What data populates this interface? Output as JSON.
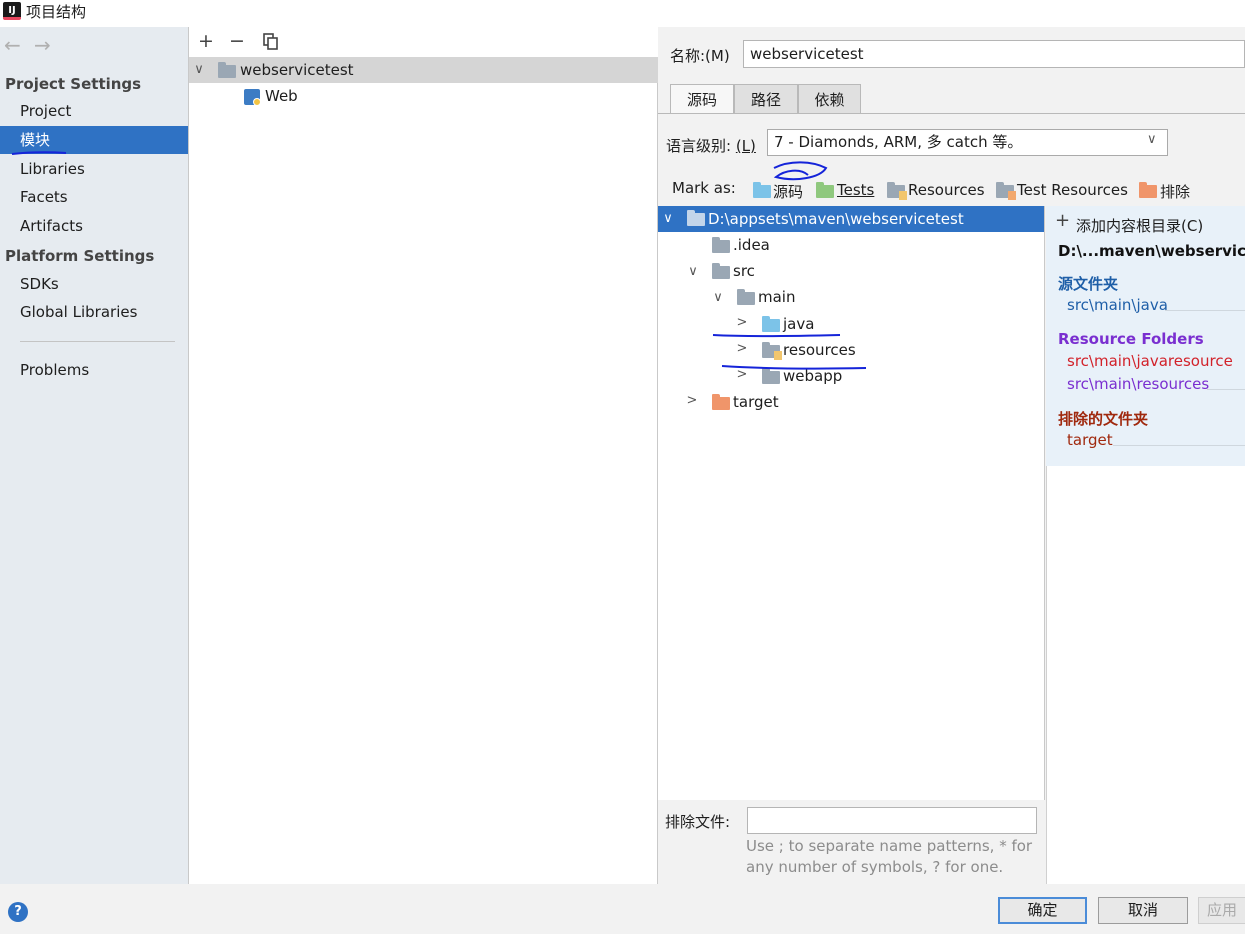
{
  "window": {
    "title": "项目结构",
    "app_icon": "IJ"
  },
  "nav": {
    "back_icon": "arrow-left-icon",
    "forward_icon": "arrow-right-icon",
    "project_settings_header": "Project Settings",
    "project_items": [
      "Project",
      "模块",
      "Libraries",
      "Facets",
      "Artifacts"
    ],
    "platform_settings_header": "Platform Settings",
    "platform_items": [
      "SDKs",
      "Global Libraries"
    ],
    "problems": "Problems",
    "selected": "模块"
  },
  "modules": {
    "toolbar": {
      "add": "+",
      "remove": "−",
      "copy": "copy-icon"
    },
    "tree": [
      {
        "label": "webservicetest"
      },
      {
        "label": "Web"
      }
    ]
  },
  "module": {
    "name_label": "名称:(M)",
    "name_value": "webservicetest",
    "tabs": [
      "源码",
      "路径",
      "依赖"
    ],
    "active_tab": "源码",
    "lang_label": "语言级别:",
    "lang_shortcut": "(L)",
    "lang_value": "7 - Diamonds, ARM, 多 catch 等。",
    "mark_as_label": "Mark as:",
    "mark_as": [
      "源码",
      "Tests",
      "Resources",
      "Test Resources",
      "排除"
    ],
    "tree": {
      "root": "D:\\appsets\\maven\\webservicetest",
      "idea": ".idea",
      "src": "src",
      "main": "main",
      "java": "java",
      "resources": "resources",
      "webapp": "webapp",
      "target": "target"
    },
    "content_root": {
      "add_label": "添加内容根目录(C)",
      "path": "D:\\...maven\\webservicetest",
      "source_header": "源文件夹",
      "source_items": [
        "src\\main\\java"
      ],
      "resource_header": "Resource Folders",
      "resource_items": [
        "src\\main\\javaresource",
        "src\\main\\resources"
      ],
      "excluded_header": "排除的文件夹",
      "excluded_items": [
        "target"
      ]
    },
    "exclude_label": "排除文件:",
    "exclude_value": "",
    "exclude_hint_1": "Use ; to separate name patterns, * for",
    "exclude_hint_2": "any number of symbols, ? for one."
  },
  "footer": {
    "help": "?",
    "ok": "确定",
    "cancel": "取消",
    "apply": "应用"
  },
  "colors": {
    "selection": "#2f72c4",
    "source": "#1f5fa8",
    "resource": "#7a2fd0",
    "resource_missing": "#d2222a",
    "excluded": "#a0290e",
    "annotation": "#1524d9"
  }
}
